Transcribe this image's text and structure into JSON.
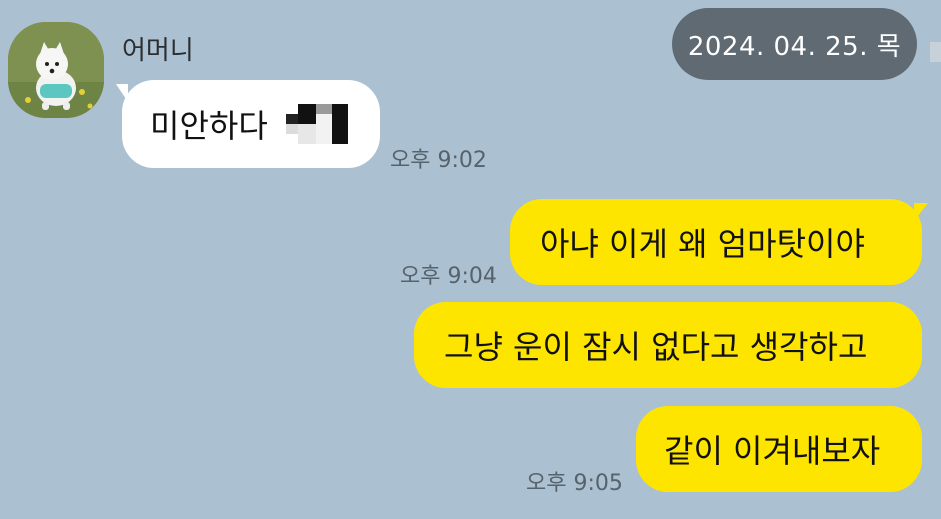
{
  "date_divider": "2024. 04. 25. 목",
  "incoming": {
    "sender_name": "어머니",
    "message_text": "미안하다",
    "time": "오후 9:02"
  },
  "outgoing": [
    {
      "text": "아냐 이게 왜 엄마탓이야",
      "time": "오후 9:04"
    },
    {
      "text": "그냥 운이 잠시 없다고 생각하고",
      "time": ""
    },
    {
      "text": "같이 이겨내보자",
      "time": "오후 9:05"
    }
  ],
  "colors": {
    "background": "#abc1d1",
    "outgoing_bubble": "#fee500",
    "incoming_bubble": "#ffffff",
    "date_pill": "#5f6a73"
  },
  "icons": {
    "avatar": "dog-avatar-photo",
    "emoji": "pixelated-emoji-icon"
  }
}
